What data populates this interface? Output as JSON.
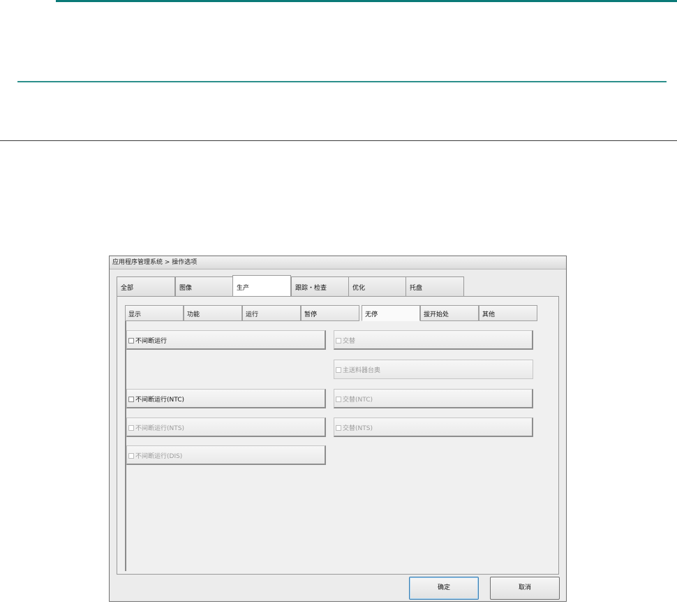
{
  "window_title": "应用程序管理系统 > 操作选项",
  "tabs": [
    {
      "label": "全部"
    },
    {
      "label": "图像"
    },
    {
      "label": "生产"
    },
    {
      "label": "跟踪・检查"
    },
    {
      "label": "优化"
    },
    {
      "label": "托盘"
    }
  ],
  "active_tab": "生产",
  "subtabs": [
    {
      "label": "显示"
    },
    {
      "label": "功能"
    },
    {
      "label": "运行"
    },
    {
      "label": "暂停"
    },
    {
      "label": "无停"
    },
    {
      "label": "拔开始处"
    },
    {
      "label": "其他"
    }
  ],
  "active_subtab": "无停",
  "options": [
    {
      "label": "不间断运行",
      "checked": false,
      "enabled": true
    },
    {
      "label": "交替",
      "checked": false,
      "enabled": false
    },
    {
      "label": "主送料器台奥",
      "checked": false,
      "enabled": false
    },
    {
      "label": "不间断运行(NTC)",
      "checked": false,
      "enabled": true
    },
    {
      "label": "交替(NTC)",
      "checked": false,
      "enabled": false
    },
    {
      "label": "不间断运行(NTS)",
      "checked": false,
      "enabled": false
    },
    {
      "label": "交替(NTS)",
      "checked": false,
      "enabled": false
    },
    {
      "label": "不间断运行(DIS)",
      "checked": false,
      "enabled": false
    }
  ],
  "buttons": {
    "ok": "确定",
    "cancel": "取消"
  },
  "colors": {
    "accent_rule": "#0a7a78",
    "dialog_bg": "#ececec"
  }
}
